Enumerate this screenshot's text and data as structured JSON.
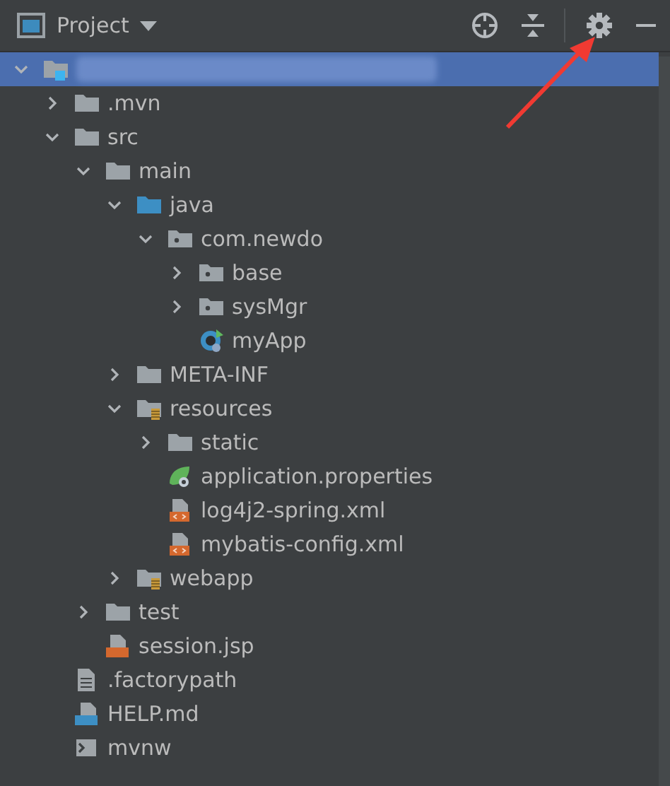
{
  "header": {
    "title": "Project"
  },
  "tree": [
    {
      "kind": "module",
      "redacted": true,
      "expanded": true,
      "selected": true,
      "children": [
        {
          "kind": "folder",
          "label": ".mvn",
          "expanded": false,
          "selected": false
        },
        {
          "kind": "folder",
          "label": "src",
          "expanded": true,
          "selected": false,
          "children": [
            {
              "kind": "folder",
              "label": "main",
              "expanded": true,
              "selected": false,
              "children": [
                {
                  "kind": "source",
                  "label": "java",
                  "expanded": true,
                  "selected": false,
                  "children": [
                    {
                      "kind": "package",
                      "label": "com.newdo",
                      "expanded": true,
                      "selected": false,
                      "children": [
                        {
                          "kind": "package",
                          "label": "base",
                          "expanded": false,
                          "selected": false
                        },
                        {
                          "kind": "package",
                          "label": "sysMgr",
                          "expanded": false,
                          "selected": false
                        },
                        {
                          "kind": "spring-class",
                          "label": "myApp",
                          "selected": false
                        }
                      ]
                    }
                  ]
                },
                {
                  "kind": "folder",
                  "label": "META-INF",
                  "expanded": false,
                  "selected": false
                },
                {
                  "kind": "resources",
                  "label": "resources",
                  "expanded": true,
                  "selected": false,
                  "children": [
                    {
                      "kind": "folder",
                      "label": "static",
                      "expanded": false,
                      "selected": false
                    },
                    {
                      "kind": "properties",
                      "label": "application.properties",
                      "selected": false
                    },
                    {
                      "kind": "xml",
                      "label": "log4j2-spring.xml",
                      "selected": false
                    },
                    {
                      "kind": "xml",
                      "label": "mybatis-config.xml",
                      "selected": false
                    }
                  ]
                },
                {
                  "kind": "resources",
                  "label": "webapp",
                  "expanded": false,
                  "selected": false
                }
              ]
            },
            {
              "kind": "folder",
              "label": "test",
              "expanded": false,
              "selected": false
            },
            {
              "kind": "jsp",
              "label": "session.jsp",
              "selected": false
            }
          ]
        },
        {
          "kind": "text",
          "label": ".factorypath",
          "selected": false
        },
        {
          "kind": "markdown",
          "label": "HELP.md",
          "selected": false
        },
        {
          "kind": "script",
          "label": "mvnw",
          "selected": false
        }
      ]
    }
  ]
}
